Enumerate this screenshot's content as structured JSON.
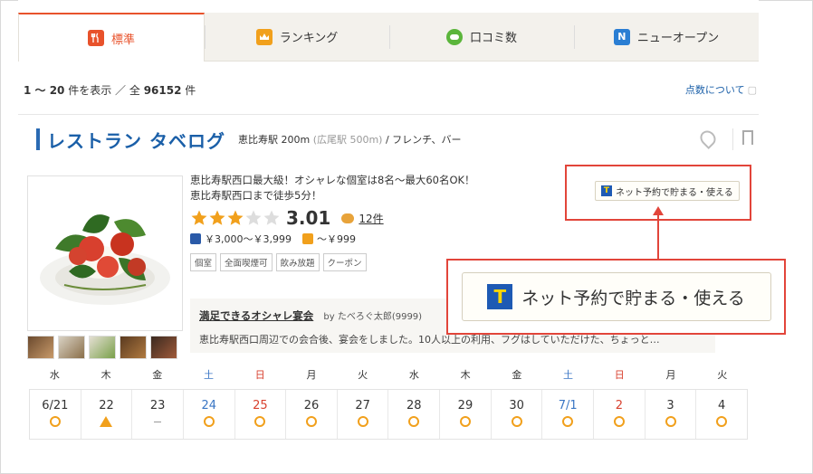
{
  "tabs": [
    {
      "label": "標準",
      "icon": "fork-knife-icon",
      "color": "#e8522b"
    },
    {
      "label": "ランキング",
      "icon": "crown-icon",
      "color": "#f1a01c"
    },
    {
      "label": "口コミ数",
      "icon": "chat-icon",
      "color": "#5bb53b"
    },
    {
      "label": "ニューオープン",
      "icon": "new-icon",
      "color": "#2a7ed3"
    }
  ],
  "results": {
    "range": "1 ～ 20",
    "range_suffix": "件を表示 ／ 全",
    "total": "96152",
    "unit": "件"
  },
  "score_link": "点数について",
  "store": {
    "name": "レストラン タベログ",
    "station": "恵比寿駅 200m",
    "nearby": "(広尾駅 500m)",
    "genre": "/ フレンチ、バー",
    "catch_1": "恵比寿駅西口最大級！オシャレな個室は8名～最大60名OK！",
    "catch_2": "恵比寿駅西口まで徒歩5分！",
    "rating": 3.01,
    "rating_text": "3.01",
    "stars_full": 3,
    "stars_total": 5,
    "review_count": "12件",
    "dinner_price": "￥3,000～￥3,999",
    "lunch_price": "～￥999",
    "tags": [
      "個室",
      "全面喫煙可",
      "飲み放題",
      "クーポン"
    ]
  },
  "review": {
    "title": "満足できるオシャレ宴会",
    "by": "by たべろぐ太郎(9999)",
    "body": "恵比寿駅西口周辺での会合後、宴会をしました。10人以上の利用、フグはしていただけた、ちょっと…"
  },
  "tpoint": {
    "label": "ネット予約で貯まる・使える",
    "mark": "T"
  },
  "calendar": {
    "weekdays": [
      "水",
      "木",
      "金",
      "土",
      "日",
      "月",
      "火",
      "水",
      "木",
      "金",
      "土",
      "日",
      "月",
      "火"
    ],
    "days": [
      {
        "date": "6/21",
        "type": "",
        "mark": "circle"
      },
      {
        "date": "22",
        "type": "",
        "mark": "triangle"
      },
      {
        "date": "23",
        "type": "",
        "mark": "dash"
      },
      {
        "date": "24",
        "type": "sat",
        "mark": "circle"
      },
      {
        "date": "25",
        "type": "sun",
        "mark": "circle"
      },
      {
        "date": "26",
        "type": "",
        "mark": "circle"
      },
      {
        "date": "27",
        "type": "",
        "mark": "circle"
      },
      {
        "date": "28",
        "type": "",
        "mark": "circle"
      },
      {
        "date": "29",
        "type": "",
        "mark": "circle"
      },
      {
        "date": "30",
        "type": "",
        "mark": "circle"
      },
      {
        "date": "7/1",
        "type": "sat",
        "mark": "circle"
      },
      {
        "date": "2",
        "type": "sun",
        "mark": "circle"
      },
      {
        "date": "3",
        "type": "",
        "mark": "circle"
      },
      {
        "date": "4",
        "type": "",
        "mark": "circle"
      }
    ]
  }
}
